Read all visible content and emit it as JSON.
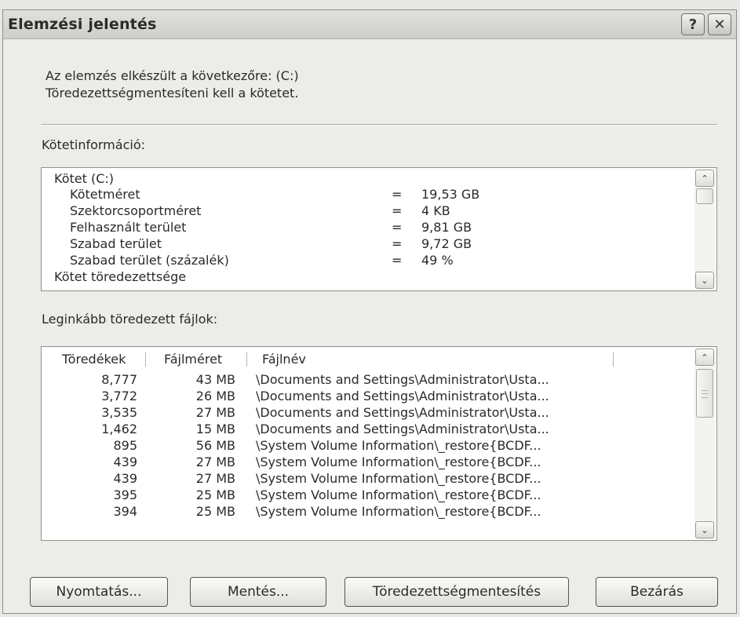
{
  "window": {
    "title": "Elemzési jelentés",
    "help_label": "?",
    "close_label": "✕"
  },
  "message": {
    "line1": "Az elemzés elkészült a következőre: (C:)",
    "line2": "Töredezettségmentesíteni kell a kötetet."
  },
  "volume_section": {
    "label": "Kötetinformáció:",
    "header": "Kötet (C:)",
    "rows": [
      {
        "label": "Kötetméret",
        "eq": "=",
        "value": "19,53 GB"
      },
      {
        "label": "Szektorcsoportméret",
        "eq": "=",
        "value": "4 KB"
      },
      {
        "label": "Felhasznált terület",
        "eq": "=",
        "value": "9,81 GB"
      },
      {
        "label": "Szabad terület",
        "eq": "=",
        "value": "9,72 GB"
      },
      {
        "label": "Szabad terület (százalék)",
        "eq": "=",
        "value": "49 %"
      }
    ],
    "footer": "Kötet töredezettsége",
    "scrollbar": {
      "up": "⌃",
      "down": "⌄"
    }
  },
  "files_section": {
    "label": "Leginkább töredezett fájlok:",
    "columns": [
      "Töredékek",
      "Fájlméret",
      "Fájlnév"
    ],
    "rows": [
      [
        "8,777",
        "43 MB",
        "\\Documents and Settings\\Administrator\\Usta..."
      ],
      [
        "3,772",
        "26 MB",
        "\\Documents and Settings\\Administrator\\Usta..."
      ],
      [
        "3,535",
        "27 MB",
        "\\Documents and Settings\\Administrator\\Usta..."
      ],
      [
        "1,462",
        "15 MB",
        "\\Documents and Settings\\Administrator\\Usta..."
      ],
      [
        "895",
        "56 MB",
        "\\System Volume Information\\_restore{BCDF..."
      ],
      [
        "439",
        "27 MB",
        "\\System Volume Information\\_restore{BCDF..."
      ],
      [
        "439",
        "27 MB",
        "\\System Volume Information\\_restore{BCDF..."
      ],
      [
        "395",
        "25 MB",
        "\\System Volume Information\\_restore{BCDF..."
      ],
      [
        "394",
        "25 MB",
        "\\System Volume Information\\_restore{BCDF..."
      ]
    ],
    "scrollbar": {
      "up": "⌃",
      "down": "⌄"
    }
  },
  "buttons": {
    "print": "Nyomtatás...",
    "save": "Mentés...",
    "defrag": "Töredezettségmentesítés",
    "close": "Bezárás"
  }
}
